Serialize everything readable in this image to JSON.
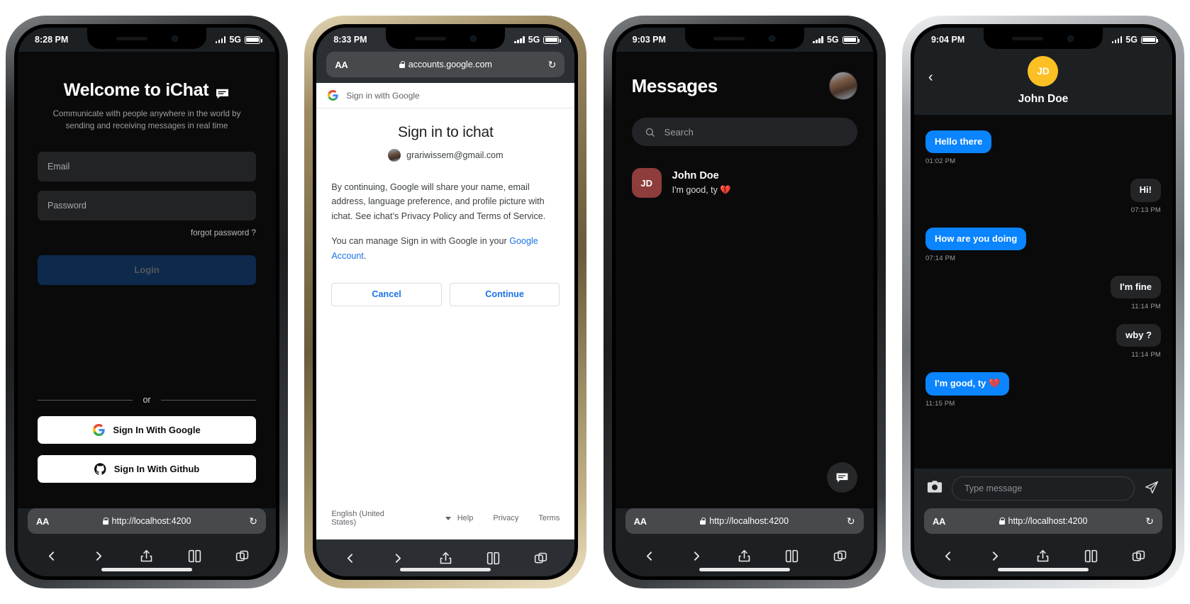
{
  "colors": {
    "accent_blue": "#0a84ff",
    "login_button_bg": "#0d2a4d",
    "avatar_yellow": "#fcc024",
    "avatar_maroon": "#8e3c3c",
    "google_link_blue": "#1a73e8",
    "screen_bg": "#0a0a0b"
  },
  "phone1": {
    "status": {
      "time": "8:28 PM",
      "network": "5G"
    },
    "title": "Welcome to iChat",
    "subtitle": "Communicate with people anywhere in the world by sending and receiving messages in real time",
    "email_placeholder": "Email",
    "password_placeholder": "Password",
    "forgot_label": "forgot password ?",
    "login_label": "Login",
    "divider_label": "or",
    "google_label": "Sign In With Google",
    "github_label": "Sign In With Github",
    "safari": {
      "aa": "AA",
      "url": "http://localhost:4200"
    }
  },
  "phone2": {
    "status": {
      "time": "8:33 PM",
      "network": "5G"
    },
    "safari_top": {
      "aa": "AA",
      "url": "accounts.google.com"
    },
    "header_label": "Sign in with Google",
    "title": "Sign in to ichat",
    "account_email": "grariwissem@gmail.com",
    "consent_p1": "By continuing, Google will share your name, email address, language preference, and profile picture with ichat. See ichat’s Privacy Policy and Terms of Service.",
    "consent_p2_prefix": "You can manage Sign in with Google in your ",
    "consent_link": "Google Account",
    "consent_p2_suffix": ".",
    "cancel_label": "Cancel",
    "continue_label": "Continue",
    "language": "English (United States)",
    "footer_links": [
      "Help",
      "Privacy",
      "Terms"
    ]
  },
  "phone3": {
    "status": {
      "time": "9:03 PM",
      "network": "5G"
    },
    "title": "Messages",
    "search_placeholder": "Search",
    "conversations": [
      {
        "initials": "JD",
        "name": "John Doe",
        "last_message": "I'm good, ty 💔"
      }
    ],
    "safari": {
      "aa": "AA",
      "url": "http://localhost:4200"
    }
  },
  "phone4": {
    "status": {
      "time": "9:04 PM",
      "network": "5G"
    },
    "contact_initials": "JD",
    "contact_name": "John Doe",
    "messages": [
      {
        "text": "Hello there",
        "time": "01:02 PM",
        "side": "out"
      },
      {
        "text": "Hi!",
        "time": "07:13 PM",
        "side": "in"
      },
      {
        "text": "How are you doing",
        "time": "07:14 PM",
        "side": "out"
      },
      {
        "text": "I'm fine",
        "time": "11:14 PM",
        "side": "in"
      },
      {
        "text": "wby ?",
        "time": "11:14 PM",
        "side": "in"
      },
      {
        "text": "I'm good, ty 💔",
        "time": "11:15 PM",
        "side": "out"
      }
    ],
    "composer_placeholder": "Type message",
    "safari": {
      "aa": "AA",
      "url": "http://localhost:4200"
    }
  }
}
